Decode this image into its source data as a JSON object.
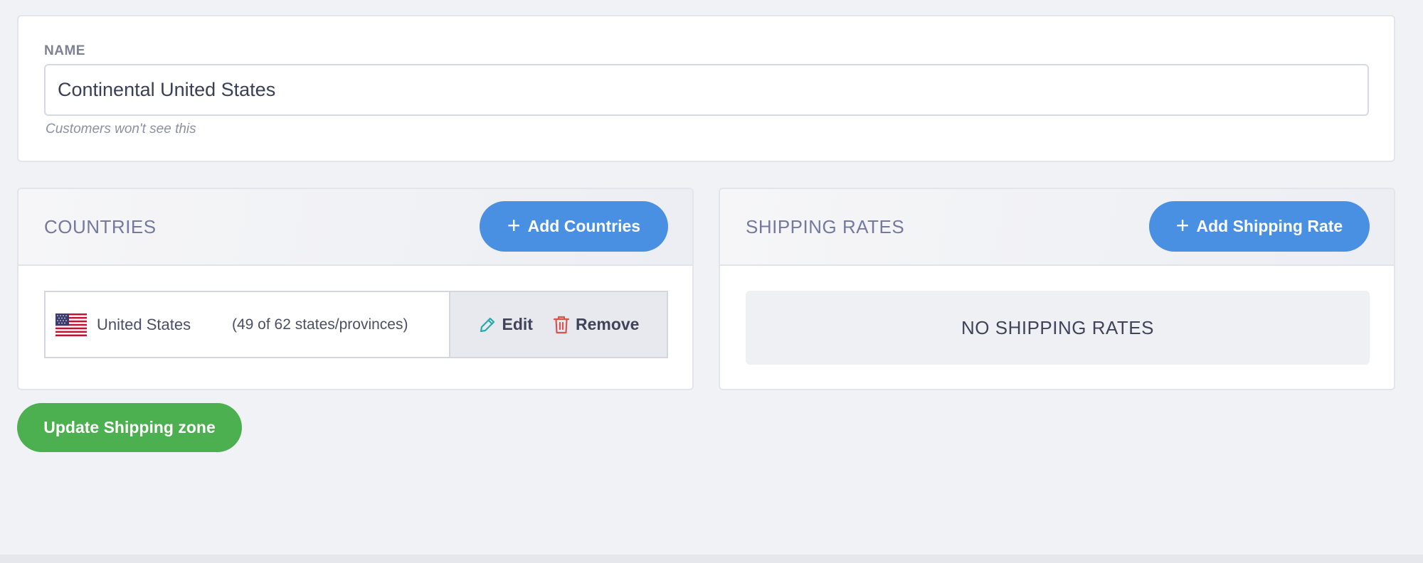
{
  "name_section": {
    "label": "NAME",
    "value": "Continental United States",
    "hint": "Customers won't see this"
  },
  "countries": {
    "title": "COUNTRIES",
    "add_label": "Add Countries",
    "items": [
      {
        "name": "United States",
        "count": "(49 of 62 states/provinces)",
        "flag_icon": "us-flag-icon",
        "edit_label": "Edit",
        "remove_label": "Remove"
      }
    ]
  },
  "shipping_rates": {
    "title": "SHIPPING RATES",
    "add_label": "Add Shipping Rate",
    "empty_text": "NO SHIPPING RATES"
  },
  "update_label": "Update Shipping zone",
  "colors": {
    "primary": "#4a90e2",
    "success": "#4caf50",
    "danger": "#d9534f",
    "edit_icon": "#2aa9a9",
    "background": "#f1f2f6"
  },
  "icons": [
    "plus-icon",
    "pencil-icon",
    "trash-icon",
    "us-flag-icon"
  ]
}
